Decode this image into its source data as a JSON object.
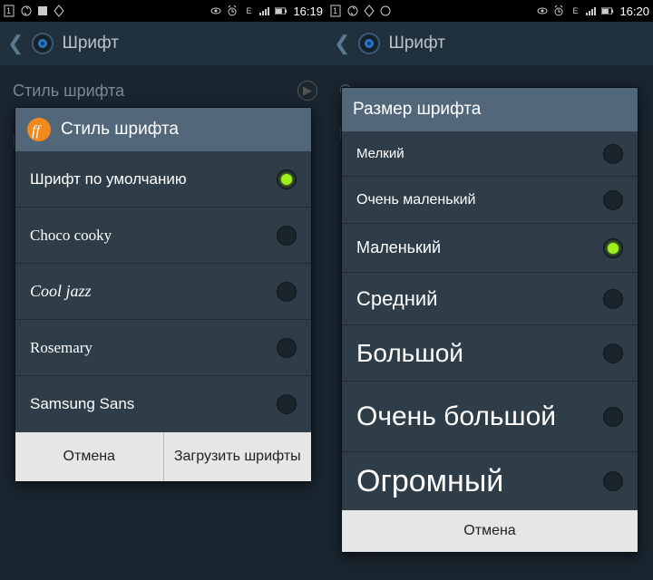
{
  "left": {
    "status_time": "16:19",
    "header_title": "Шрифт",
    "bg_row": "Стиль шрифта",
    "dialog_title": "Стиль шрифта",
    "options": [
      {
        "label": "Шрифт по умолчанию",
        "selected": true,
        "cls": "f-default"
      },
      {
        "label": "Choco cooky",
        "selected": false,
        "cls": "f-choco"
      },
      {
        "label": "Cool jazz",
        "selected": false,
        "cls": "f-cool"
      },
      {
        "label": "Rosemary",
        "selected": false,
        "cls": "f-rose"
      },
      {
        "label": "Samsung Sans",
        "selected": false,
        "cls": "f-sams"
      }
    ],
    "btn_cancel": "Отмена",
    "btn_download": "Загрузить шрифты"
  },
  "right": {
    "status_time": "16:20",
    "header_title": "Шрифт",
    "dialog_title": "Размер шрифта",
    "options": [
      {
        "label": "Мелкий",
        "selected": false,
        "cls": "sz0"
      },
      {
        "label": "Очень маленький",
        "selected": false,
        "cls": "sz1"
      },
      {
        "label": "Маленький",
        "selected": true,
        "cls": "sz2"
      },
      {
        "label": "Средний",
        "selected": false,
        "cls": "sz3"
      },
      {
        "label": "Большой",
        "selected": false,
        "cls": "sz4"
      },
      {
        "label": "Очень большой",
        "selected": false,
        "cls": "sz5"
      },
      {
        "label": "Огромный",
        "selected": false,
        "cls": "sz6"
      }
    ],
    "btn_cancel": "Отмена"
  }
}
